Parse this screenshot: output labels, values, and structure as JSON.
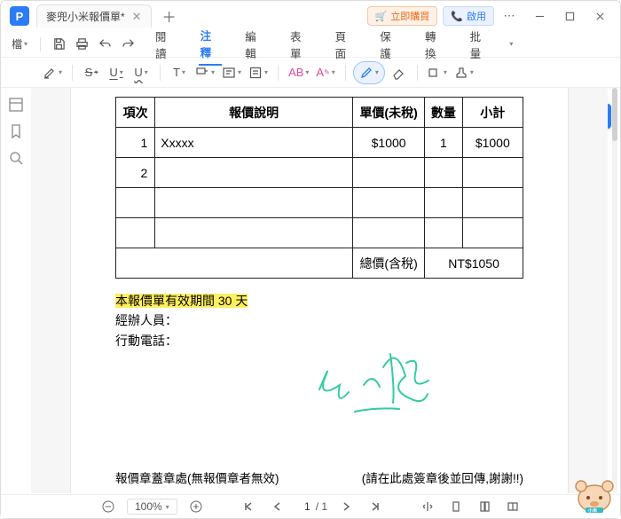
{
  "app": {
    "logo_letter": "P",
    "tab_title": "麥兜小米報價單*",
    "buy_label": "立即購買",
    "enable_label": "啟用",
    "more": "⋯"
  },
  "menu": {
    "file": "檔",
    "tabs": [
      "閱讀",
      "注釋",
      "編輯",
      "表單",
      "頁面",
      "保護",
      "轉換",
      "批量"
    ],
    "active": "注釋"
  },
  "doc": {
    "headers": {
      "item": "項次",
      "desc": "報價說明",
      "price": "單價(未稅)",
      "qty": "數量",
      "sub": "小計"
    },
    "rows": [
      {
        "item": "1",
        "desc": "Xxxxx",
        "price": "$1000",
        "qty": "1",
        "sub": "$1000"
      },
      {
        "item": "2",
        "desc": "",
        "price": "",
        "qty": "",
        "sub": ""
      },
      {
        "item": "",
        "desc": "",
        "price": "",
        "qty": "",
        "sub": ""
      },
      {
        "item": "",
        "desc": "",
        "price": "",
        "qty": "",
        "sub": ""
      }
    ],
    "total_label": "總價(含稅)",
    "total_value": "NT$1050",
    "validity": "本報價單有效期間 30 天",
    "handler": "經辦人員：",
    "mobile": "行動電話：",
    "stamp_left": "報價章蓋章處(無報價章者無效)",
    "stamp_right": "(請在此處簽章後並回傳,謝謝!!)"
  },
  "status": {
    "zoom": "100%",
    "page_current": "1",
    "page_total": "/ 1"
  },
  "icons": {
    "letter_T": "T",
    "letter_AB": "AB",
    "letter_A": "A",
    "letter_U": "U",
    "letter_S": "S"
  }
}
